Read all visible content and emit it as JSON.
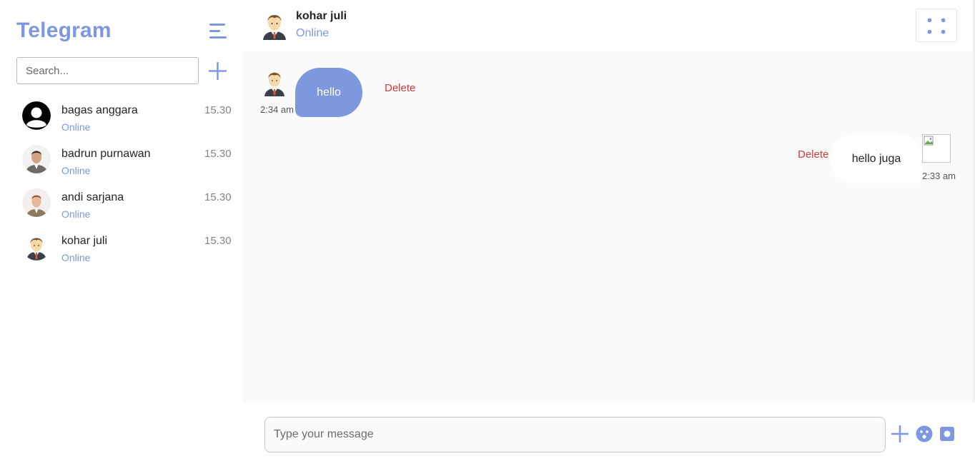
{
  "sidebar": {
    "brand": "Telegram",
    "search_placeholder": "Search...",
    "contacts": [
      {
        "name": "bagas anggara",
        "status": "Online",
        "time": "15.30",
        "avatar": "silhouette-avatar"
      },
      {
        "name": "badrun purnawan",
        "status": "Online",
        "time": "15.30",
        "avatar": "man-photo-avatar"
      },
      {
        "name": "andi sarjana",
        "status": "Online",
        "time": "15.30",
        "avatar": "man-photo-avatar"
      },
      {
        "name": "kohar juli",
        "status": "Online",
        "time": "15.30",
        "avatar": "cartoon-businessman-avatar"
      }
    ]
  },
  "chat": {
    "header": {
      "name": "kohar juli",
      "status": "Online"
    },
    "messages": [
      {
        "side": "received",
        "text": "hello",
        "time": "2:34 am",
        "action": "Delete"
      },
      {
        "side": "sent",
        "text": "hello juga",
        "time": "2:33 am",
        "action": "Delete"
      }
    ],
    "composer": {
      "placeholder": "Type your message"
    }
  },
  "colors": {
    "accent": "#7e98df",
    "delete": "#d13b3b",
    "chat_bg": "#fafafa"
  },
  "icons": [
    "menu-icon",
    "plus-icon",
    "grid-dots-icon",
    "emoji-icon",
    "camera-icon"
  ]
}
